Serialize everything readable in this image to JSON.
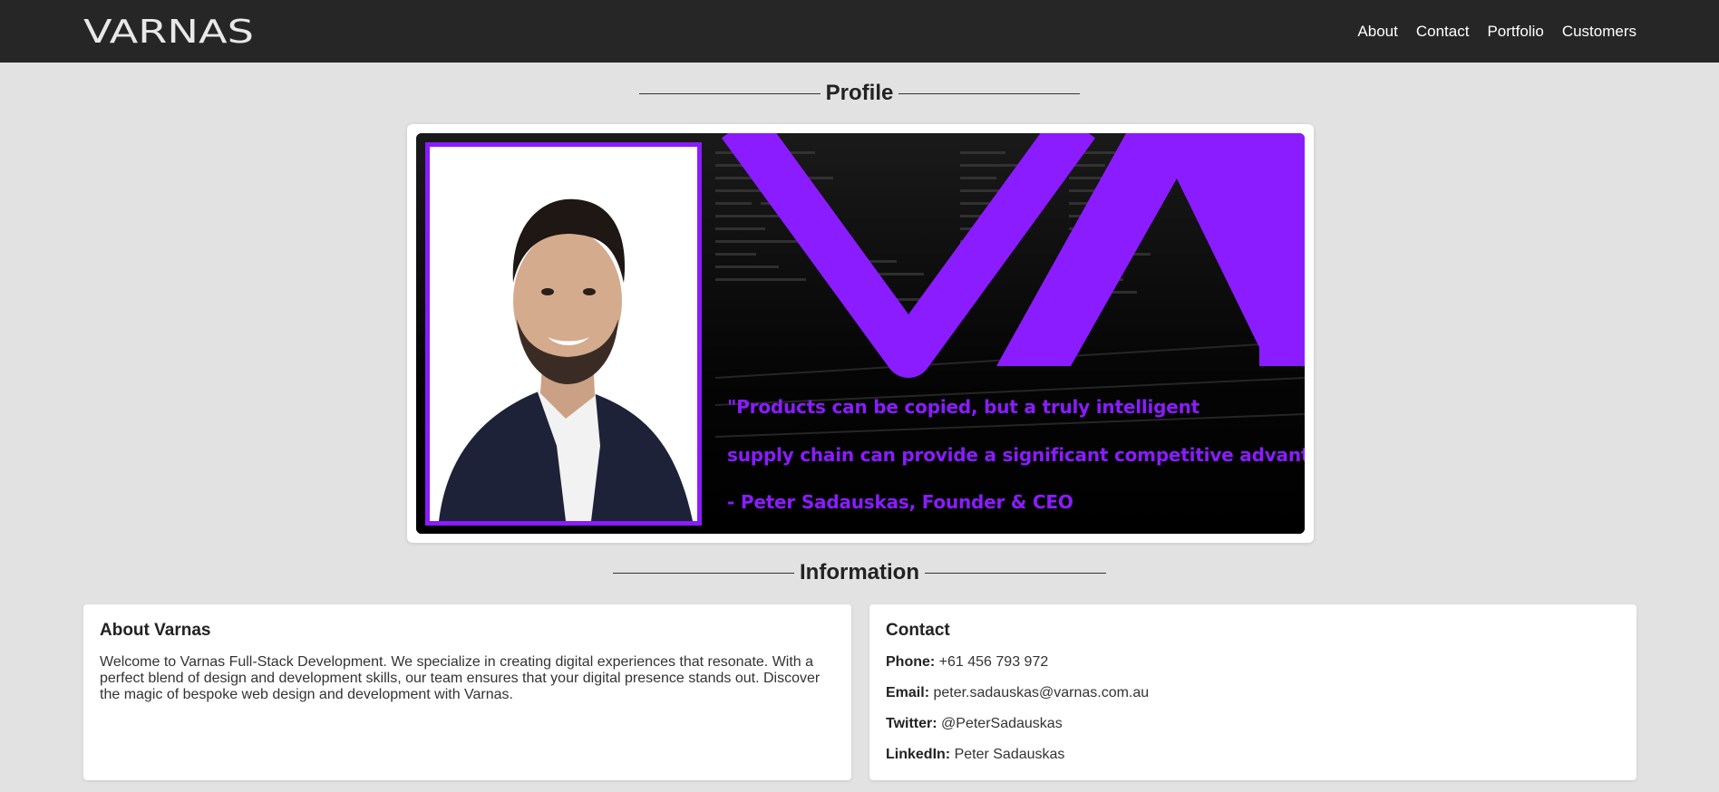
{
  "header": {
    "logo_text": "VARNAS",
    "nav": [
      "About",
      "Contact",
      "Portfolio",
      "Customers"
    ]
  },
  "profile": {
    "section_title": "Profile",
    "quote_line1": "\"Products can be copied, but a truly intelligent",
    "quote_line2": "supply chain can provide a significant competitive advantage.\"",
    "attribution": "- Peter Sadauskas, Founder & CEO"
  },
  "information": {
    "section_title": "Information",
    "about": {
      "title": "About Varnas",
      "body": "Welcome to Varnas Full-Stack Development. We specialize in creating digital experiences that resonate. With a perfect blend of design and development skills, our team ensures that your digital presence stands out. Discover the magic of bespoke web design and development with Varnas."
    },
    "contact": {
      "title": "Contact",
      "rows": [
        {
          "label": "Phone:",
          "value": "+61 456 793 972"
        },
        {
          "label": "Email:",
          "value": "peter.sadauskas@varnas.com.au"
        },
        {
          "label": "Twitter:",
          "value": "@PeterSadauskas"
        },
        {
          "label": "LinkedIn:",
          "value": "Peter Sadauskas"
        }
      ]
    }
  },
  "colors": {
    "header_bg": "#262626",
    "page_bg": "#e2e2e2",
    "accent": "#8a1cff"
  },
  "icons": {
    "logo": "varnas-logo",
    "banner_mark": "va-monogram"
  }
}
